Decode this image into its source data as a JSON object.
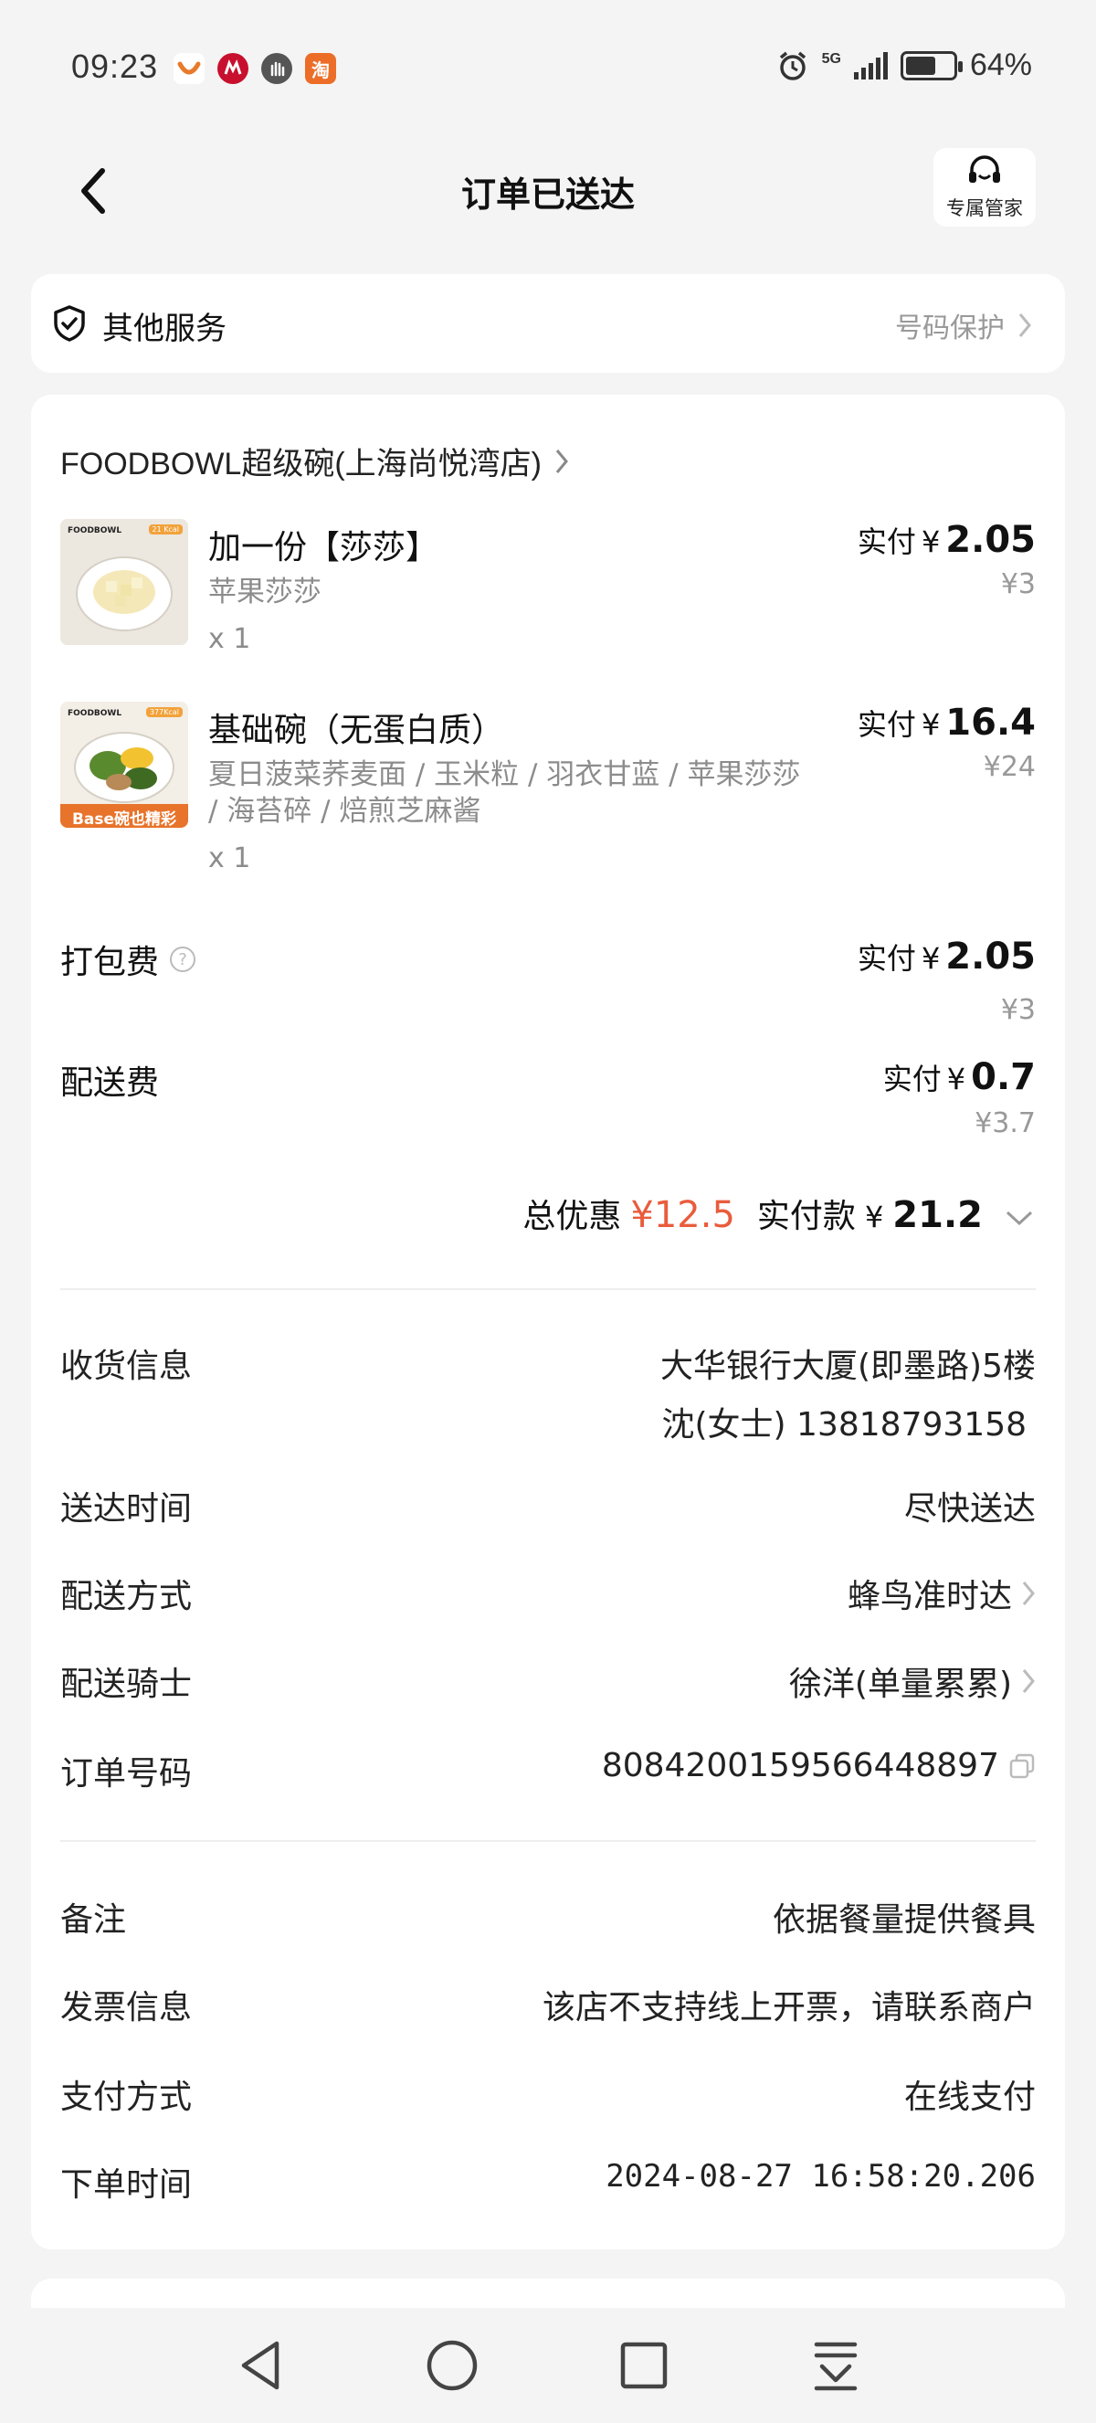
{
  "status_bar": {
    "time": "09:23",
    "network": "5G",
    "battery_text": "64%",
    "battery_level": 0.64,
    "apps": [
      "ctrip-app-icon",
      "cmb-app-icon",
      "hand-app-icon",
      "taobao-app-icon"
    ],
    "taobao_label": "淘"
  },
  "header": {
    "title": "订单已送达",
    "butler_label": "专属管家"
  },
  "service": {
    "title": "其他服务",
    "action": "号码保护"
  },
  "store": {
    "name": "FOODBOWL超级碗(上海尚悦湾店)"
  },
  "items": [
    {
      "name": "加一份【莎莎】",
      "spec": "苹果莎莎",
      "qty": "x 1",
      "paid_label": "实付",
      "currency": "¥",
      "paid": "2.05",
      "original": "¥3",
      "thumb_brand": "FOODBOWL",
      "thumb_kcal": "21 Kcal"
    },
    {
      "name": "基础碗（无蛋白质）",
      "spec": "夏日菠菜荞麦面 / 玉米粒 / 羽衣甘蓝 / 苹果莎莎 / 海苔碎 / 焙煎芝麻酱",
      "qty": "x 1",
      "paid_label": "实付",
      "currency": "¥",
      "paid": "16.4",
      "original": "¥24",
      "thumb_brand": "FOODBOWL",
      "thumb_kcal": "377Kcal",
      "thumb_banner": "Base碗也精彩"
    }
  ],
  "fees": {
    "packing": {
      "label": "打包费",
      "paid_label": "实付",
      "currency": "¥",
      "paid": "2.05",
      "original": "¥3"
    },
    "delivery": {
      "label": "配送费",
      "paid_label": "实付",
      "currency": "¥",
      "paid": "0.7",
      "original": "¥3.7"
    }
  },
  "totals": {
    "discount_label": "总优惠",
    "discount": "¥12.5",
    "pay_label": "实付款",
    "currency": "¥",
    "pay": "21.2"
  },
  "info": {
    "address_label": "收货信息",
    "address": "大华银行大厦(即墨路)5楼",
    "contact": "沈(女士) 13818793158",
    "time_label": "送达时间",
    "time": "尽快送达",
    "method_label": "配送方式",
    "method": "蜂鸟准时达",
    "rider_label": "配送骑士",
    "rider": "徐洋(单量累累)",
    "order_label": "订单号码",
    "order_no": "8084200159566448897",
    "note_label": "备注",
    "note": "依据餐量提供餐具",
    "invoice_label": "发票信息",
    "invoice": "该店不支持线上开票，请联系商户",
    "payment_label": "支付方式",
    "payment": "在线支付",
    "order_time_label": "下单时间",
    "order_time": "2024-08-27 16:58:20.206"
  },
  "colors": {
    "accent_discount": "#e95c3c",
    "background": "#f4f4f4",
    "card": "#ffffff"
  }
}
